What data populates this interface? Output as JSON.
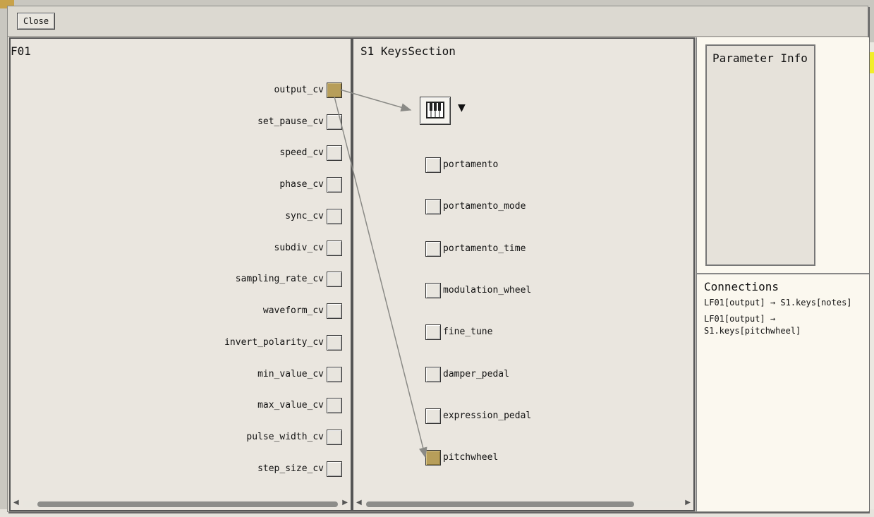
{
  "toolbar": {
    "close_label": "Close"
  },
  "left_panel": {
    "title": "F01",
    "ports": [
      {
        "label": "output_cv",
        "active": true
      },
      {
        "label": "set_pause_cv",
        "active": false
      },
      {
        "label": "speed_cv",
        "active": false
      },
      {
        "label": "phase_cv",
        "active": false
      },
      {
        "label": "sync_cv",
        "active": false
      },
      {
        "label": "subdiv_cv",
        "active": false
      },
      {
        "label": "sampling_rate_cv",
        "active": false
      },
      {
        "label": "waveform_cv",
        "active": false
      },
      {
        "label": "invert_polarity_cv",
        "active": false
      },
      {
        "label": "min_value_cv",
        "active": false
      },
      {
        "label": "max_value_cv",
        "active": false
      },
      {
        "label": "pulse_width_cv",
        "active": false
      },
      {
        "label": "step_size_cv",
        "active": false
      }
    ]
  },
  "mid_panel": {
    "title": "S1 KeysSection",
    "keys_icon": "piano-keys-icon",
    "dropdown_arrow": "▼",
    "ports": [
      {
        "label": "portamento",
        "active": false
      },
      {
        "label": "portamento_mode",
        "active": false
      },
      {
        "label": "portamento_time",
        "active": false
      },
      {
        "label": "modulation_wheel",
        "active": false
      },
      {
        "label": "fine_tune",
        "active": false
      },
      {
        "label": "damper_pedal",
        "active": false
      },
      {
        "label": "expression_pedal",
        "active": false
      },
      {
        "label": "pitchwheel",
        "active": true
      }
    ]
  },
  "info": {
    "title": "Parameter Info"
  },
  "connections": {
    "title": "Connections",
    "items": [
      "LF01[output] → S1.keys[notes]",
      "LF01[output] →",
      "S1.keys[pitchwheel]"
    ]
  },
  "colors": {
    "active_port": "#b79e5a",
    "wire": "#8a8a86",
    "panel_bg": "#eae6df"
  }
}
